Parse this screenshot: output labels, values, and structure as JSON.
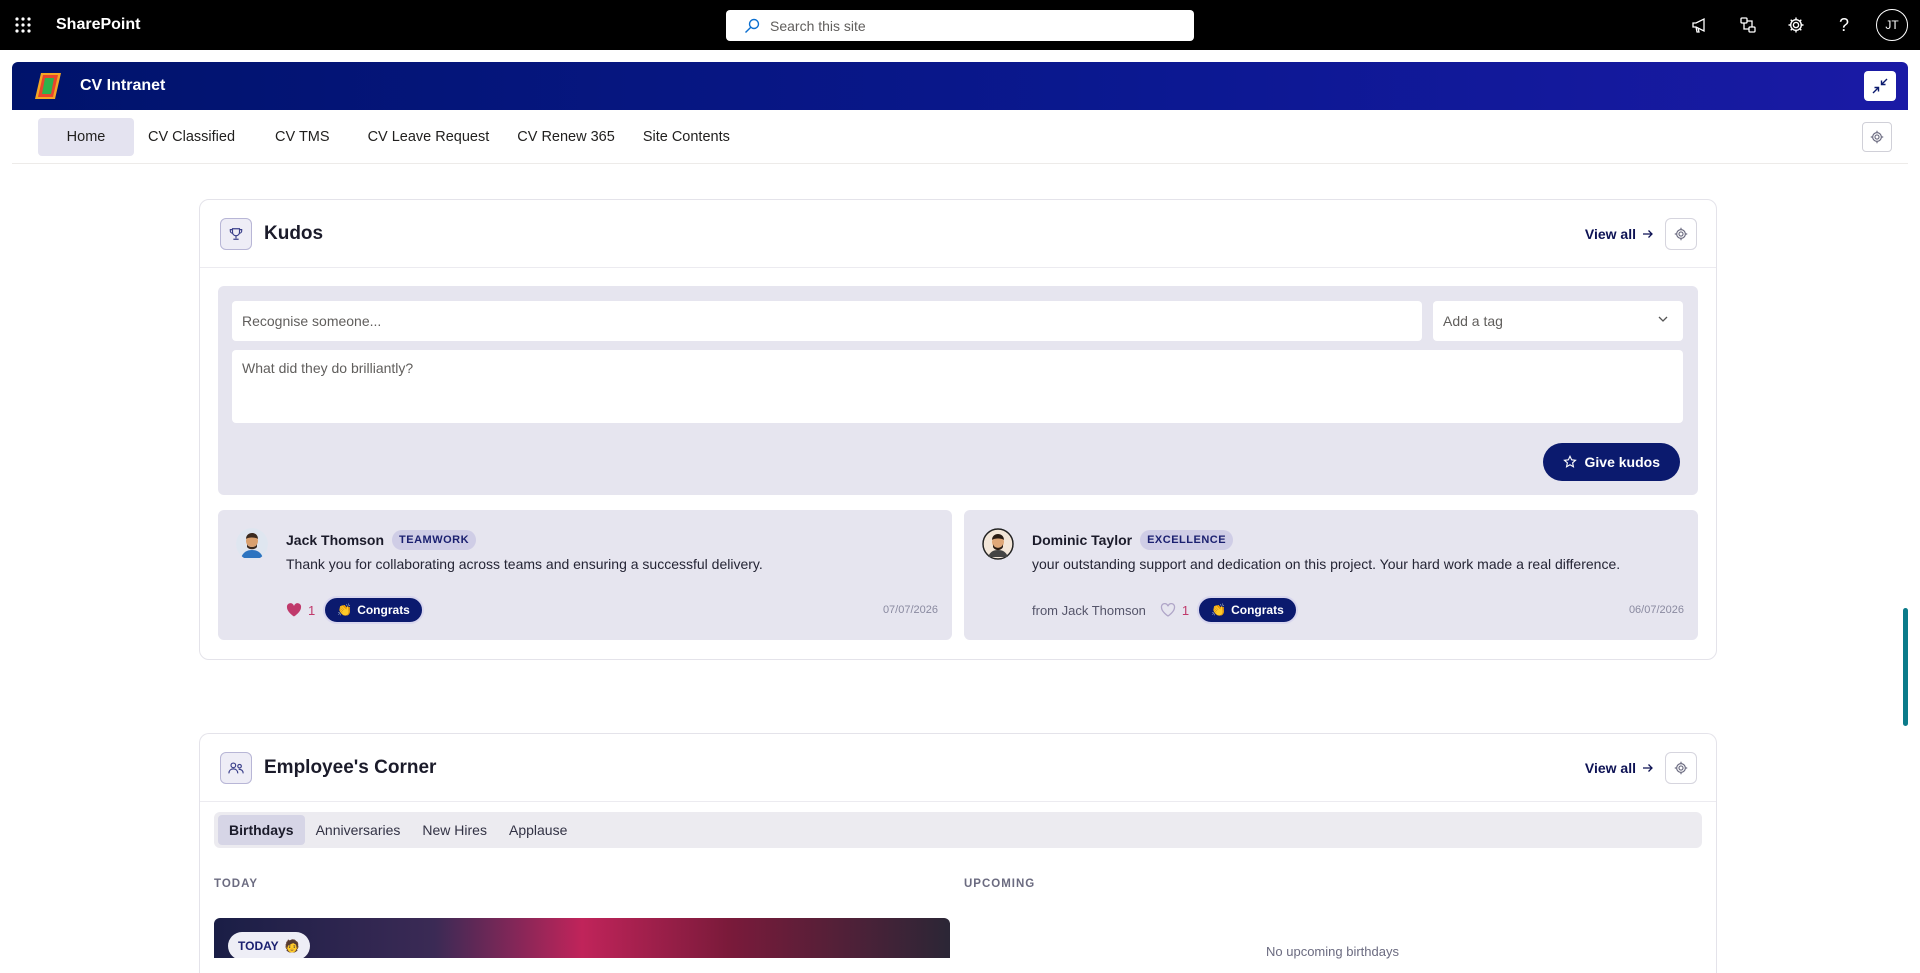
{
  "suitebar": {
    "app_name": "SharePoint",
    "search_placeholder": "Search this site",
    "user_initials": "JT"
  },
  "site": {
    "name": "CV Intranet"
  },
  "nav": {
    "items": [
      {
        "label": "Home",
        "active": true
      },
      {
        "label": "CV Classified"
      },
      {
        "label": "CV TMS"
      },
      {
        "label": "CV Leave Request"
      },
      {
        "label": "CV Renew 365"
      },
      {
        "label": "Site Contents"
      }
    ]
  },
  "kudos": {
    "title": "Kudos",
    "view_all": "View all",
    "recognise_placeholder": "Recognise someone...",
    "tag_placeholder": "Add a tag",
    "message_placeholder": "What did they do brilliantly?",
    "give_button": "Give kudos",
    "items": [
      {
        "name": "Jack Thomson",
        "badge": "TEAMWORK",
        "message": "Thank you for collaborating across teams and ensuring a successful delivery.",
        "from": "",
        "likes": "1",
        "liked": true,
        "congrats": "Congrats",
        "date": "07/07/2026"
      },
      {
        "name": "Dominic Taylor",
        "badge": "EXCELLENCE",
        "message": "your outstanding support and dedication on this project. Your hard work made a real difference.",
        "from": "from Jack Thomson",
        "likes": "1",
        "liked": false,
        "congrats": "Congrats",
        "date": "06/07/2026"
      }
    ]
  },
  "employees": {
    "title": "Employee's Corner",
    "view_all": "View all",
    "tabs": [
      {
        "label": "Birthdays",
        "active": true
      },
      {
        "label": "Anniversaries"
      },
      {
        "label": "New Hires"
      },
      {
        "label": "Applause"
      }
    ],
    "today_label": "TODAY",
    "upcoming_label": "UPCOMING",
    "today_pill": "TODAY",
    "no_upcoming": "No upcoming birthdays"
  },
  "colors": {
    "brand_dark": "#0b1a6e",
    "site_header": "#00136b",
    "panel_bg": "#e6e5ef"
  }
}
